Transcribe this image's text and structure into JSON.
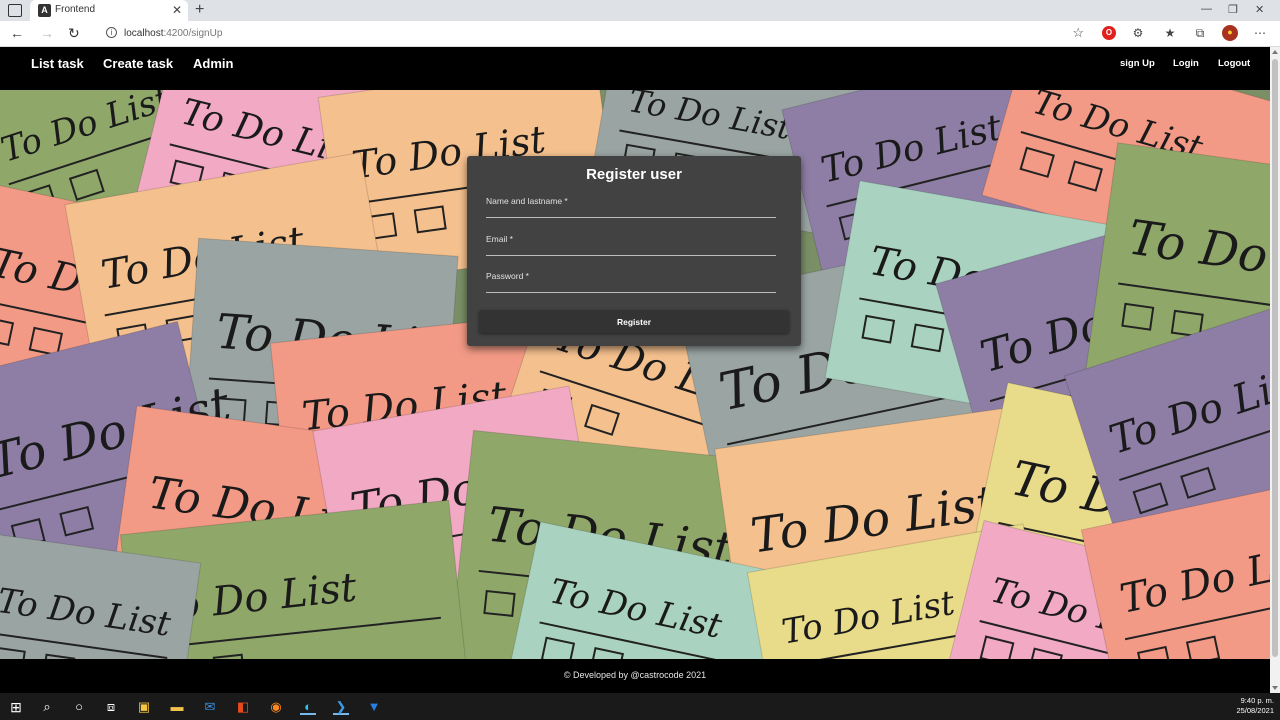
{
  "browser": {
    "tab_title": "Frontend",
    "url_host": "localhost",
    "url_path": ":4200/signUp",
    "new_tab_symbol": "+",
    "tab_close_symbol": "✕"
  },
  "navbar": {
    "links": [
      "List task",
      "Create task",
      "Admin"
    ],
    "right_links": [
      "sign Up",
      "Login",
      "Logout"
    ]
  },
  "register_form": {
    "title": "Register user",
    "fields": [
      {
        "label": "Name and lastname *",
        "value": ""
      },
      {
        "label": "Email *",
        "value": ""
      },
      {
        "label": "Password *",
        "value": ""
      }
    ],
    "submit_label": "Register"
  },
  "background": {
    "note_text": "To Do List",
    "note_colors": [
      "#8fa86a",
      "#f2a9c4",
      "#f4c08e",
      "#9aa5a3",
      "#8e7ea5",
      "#f29a86",
      "#a9d3c0",
      "#e8db8a"
    ]
  },
  "footer": {
    "text": "© Developed by @castrocode 2021"
  },
  "taskbar": {
    "time": "9:40 p. m.",
    "date": "25/08/2021"
  }
}
